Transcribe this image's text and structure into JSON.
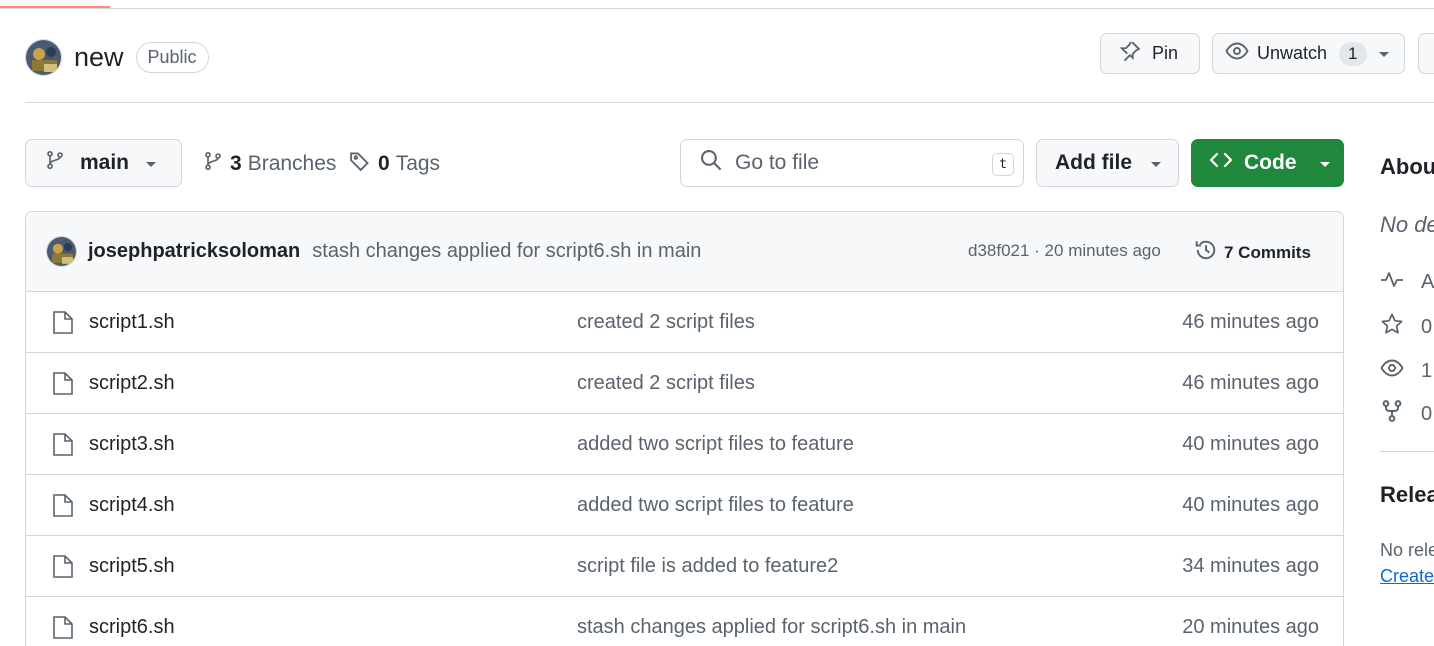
{
  "repo": {
    "name": "new",
    "visibility": "Public"
  },
  "header_actions": {
    "pin_label": "Pin",
    "watch_label": "Unwatch",
    "watch_count": "1"
  },
  "toolbar": {
    "branch": "main",
    "branches_count": "3",
    "branches_label": "Branches",
    "tags_count": "0",
    "tags_label": "Tags",
    "search_placeholder": "Go to file",
    "search_shortcut": "t",
    "add_file_label": "Add file",
    "code_label": "Code"
  },
  "latest_commit": {
    "author": "josephpatricksoloman",
    "message": "stash changes applied for script6.sh in main",
    "meta": "d38f021 · 20 minutes ago",
    "commits_label": "7 Commits"
  },
  "files": [
    {
      "name": "script1.sh",
      "message": "created 2 script files",
      "age": "46 minutes ago"
    },
    {
      "name": "script2.sh",
      "message": "created 2 script files",
      "age": "46 minutes ago"
    },
    {
      "name": "script3.sh",
      "message": "added two script files to feature",
      "age": "40 minutes ago"
    },
    {
      "name": "script4.sh",
      "message": "added two script files to feature",
      "age": "40 minutes ago"
    },
    {
      "name": "script5.sh",
      "message": "script file is added to feature2",
      "age": "34 minutes ago"
    },
    {
      "name": "script6.sh",
      "message": "stash changes applied for script6.sh in main",
      "age": "20 minutes ago"
    }
  ],
  "sidebar": {
    "about_title": "Abou",
    "description": "No de",
    "activity": "A",
    "stars": "0",
    "watchers": "1",
    "forks": "0",
    "releases_title": "Relea",
    "no_releases": "No rele",
    "create_link": "Create"
  },
  "colors": {
    "primary_button": "#1f883d",
    "link": "#0969da",
    "border": "#d0d7de",
    "muted_text": "#59636e",
    "progress_accent": "#fd8c73"
  }
}
